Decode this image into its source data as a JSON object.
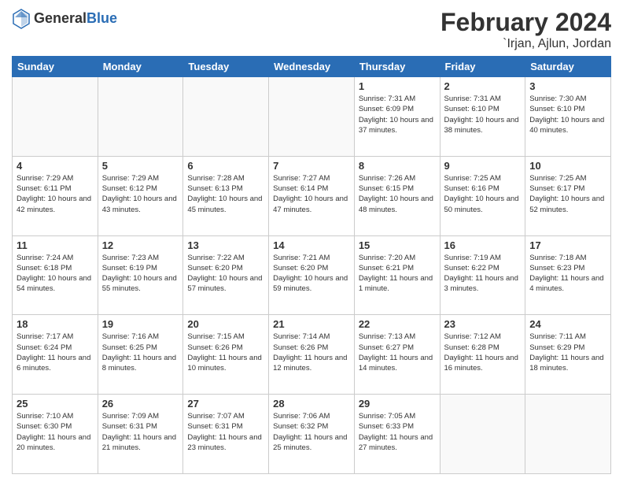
{
  "header": {
    "logo_general": "General",
    "logo_blue": "Blue",
    "title": "February 2024",
    "subtitle": "`Irjan, Ajlun, Jordan"
  },
  "days_of_week": [
    "Sunday",
    "Monday",
    "Tuesday",
    "Wednesday",
    "Thursday",
    "Friday",
    "Saturday"
  ],
  "weeks": [
    [
      {
        "day": "",
        "info": ""
      },
      {
        "day": "",
        "info": ""
      },
      {
        "day": "",
        "info": ""
      },
      {
        "day": "",
        "info": ""
      },
      {
        "day": "1",
        "info": "Sunrise: 7:31 AM\nSunset: 6:09 PM\nDaylight: 10 hours and 37 minutes."
      },
      {
        "day": "2",
        "info": "Sunrise: 7:31 AM\nSunset: 6:10 PM\nDaylight: 10 hours and 38 minutes."
      },
      {
        "day": "3",
        "info": "Sunrise: 7:30 AM\nSunset: 6:10 PM\nDaylight: 10 hours and 40 minutes."
      }
    ],
    [
      {
        "day": "4",
        "info": "Sunrise: 7:29 AM\nSunset: 6:11 PM\nDaylight: 10 hours and 42 minutes."
      },
      {
        "day": "5",
        "info": "Sunrise: 7:29 AM\nSunset: 6:12 PM\nDaylight: 10 hours and 43 minutes."
      },
      {
        "day": "6",
        "info": "Sunrise: 7:28 AM\nSunset: 6:13 PM\nDaylight: 10 hours and 45 minutes."
      },
      {
        "day": "7",
        "info": "Sunrise: 7:27 AM\nSunset: 6:14 PM\nDaylight: 10 hours and 47 minutes."
      },
      {
        "day": "8",
        "info": "Sunrise: 7:26 AM\nSunset: 6:15 PM\nDaylight: 10 hours and 48 minutes."
      },
      {
        "day": "9",
        "info": "Sunrise: 7:25 AM\nSunset: 6:16 PM\nDaylight: 10 hours and 50 minutes."
      },
      {
        "day": "10",
        "info": "Sunrise: 7:25 AM\nSunset: 6:17 PM\nDaylight: 10 hours and 52 minutes."
      }
    ],
    [
      {
        "day": "11",
        "info": "Sunrise: 7:24 AM\nSunset: 6:18 PM\nDaylight: 10 hours and 54 minutes."
      },
      {
        "day": "12",
        "info": "Sunrise: 7:23 AM\nSunset: 6:19 PM\nDaylight: 10 hours and 55 minutes."
      },
      {
        "day": "13",
        "info": "Sunrise: 7:22 AM\nSunset: 6:20 PM\nDaylight: 10 hours and 57 minutes."
      },
      {
        "day": "14",
        "info": "Sunrise: 7:21 AM\nSunset: 6:20 PM\nDaylight: 10 hours and 59 minutes."
      },
      {
        "day": "15",
        "info": "Sunrise: 7:20 AM\nSunset: 6:21 PM\nDaylight: 11 hours and 1 minute."
      },
      {
        "day": "16",
        "info": "Sunrise: 7:19 AM\nSunset: 6:22 PM\nDaylight: 11 hours and 3 minutes."
      },
      {
        "day": "17",
        "info": "Sunrise: 7:18 AM\nSunset: 6:23 PM\nDaylight: 11 hours and 4 minutes."
      }
    ],
    [
      {
        "day": "18",
        "info": "Sunrise: 7:17 AM\nSunset: 6:24 PM\nDaylight: 11 hours and 6 minutes."
      },
      {
        "day": "19",
        "info": "Sunrise: 7:16 AM\nSunset: 6:25 PM\nDaylight: 11 hours and 8 minutes."
      },
      {
        "day": "20",
        "info": "Sunrise: 7:15 AM\nSunset: 6:26 PM\nDaylight: 11 hours and 10 minutes."
      },
      {
        "day": "21",
        "info": "Sunrise: 7:14 AM\nSunset: 6:26 PM\nDaylight: 11 hours and 12 minutes."
      },
      {
        "day": "22",
        "info": "Sunrise: 7:13 AM\nSunset: 6:27 PM\nDaylight: 11 hours and 14 minutes."
      },
      {
        "day": "23",
        "info": "Sunrise: 7:12 AM\nSunset: 6:28 PM\nDaylight: 11 hours and 16 minutes."
      },
      {
        "day": "24",
        "info": "Sunrise: 7:11 AM\nSunset: 6:29 PM\nDaylight: 11 hours and 18 minutes."
      }
    ],
    [
      {
        "day": "25",
        "info": "Sunrise: 7:10 AM\nSunset: 6:30 PM\nDaylight: 11 hours and 20 minutes."
      },
      {
        "day": "26",
        "info": "Sunrise: 7:09 AM\nSunset: 6:31 PM\nDaylight: 11 hours and 21 minutes."
      },
      {
        "day": "27",
        "info": "Sunrise: 7:07 AM\nSunset: 6:31 PM\nDaylight: 11 hours and 23 minutes."
      },
      {
        "day": "28",
        "info": "Sunrise: 7:06 AM\nSunset: 6:32 PM\nDaylight: 11 hours and 25 minutes."
      },
      {
        "day": "29",
        "info": "Sunrise: 7:05 AM\nSunset: 6:33 PM\nDaylight: 11 hours and 27 minutes."
      },
      {
        "day": "",
        "info": ""
      },
      {
        "day": "",
        "info": ""
      }
    ]
  ]
}
